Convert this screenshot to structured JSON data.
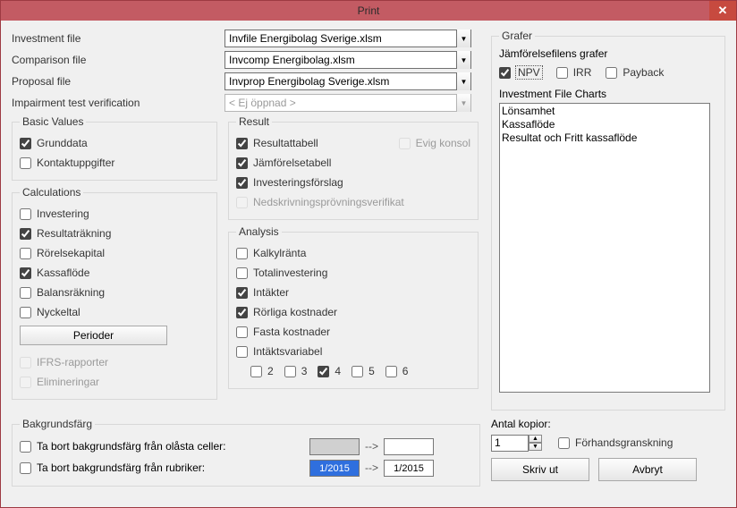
{
  "title": "Print",
  "files": {
    "investment_file_label": "Investment file",
    "comparison_file_label": "Comparison file",
    "proposal_file_label": "Proposal file",
    "impairment_label": "Impairment test verification",
    "investment_file_value": "Invfile Energibolag Sverige.xlsm",
    "comparison_file_value": "Invcomp Energibolag.xlsm",
    "proposal_file_value": "Invprop Energibolag Sverige.xlsm",
    "impairment_value": "< Ej öppnad >"
  },
  "basic_values": {
    "legend": "Basic Values",
    "grunddata": {
      "label": "Grunddata",
      "checked": true
    },
    "kontaktuppgifter": {
      "label": "Kontaktuppgifter",
      "checked": false
    }
  },
  "calculations": {
    "legend": "Calculations",
    "investering": {
      "label": "Investering",
      "checked": false
    },
    "resultatrakning": {
      "label": "Resultaträkning",
      "checked": true
    },
    "rorelsekapital": {
      "label": "Rörelsekapital",
      "checked": false
    },
    "kassaflode": {
      "label": "Kassaflöde",
      "checked": true
    },
    "balansrakning": {
      "label": "Balansräkning",
      "checked": false
    },
    "nyckeltal": {
      "label": "Nyckeltal",
      "checked": false
    },
    "perioder_btn": "Perioder",
    "ifrs": {
      "label": "IFRS-rapporter",
      "checked": false
    },
    "elimineringar": {
      "label": "Elimineringar",
      "checked": false
    }
  },
  "result": {
    "legend": "Result",
    "resultattabell": {
      "label": "Resultattabell",
      "checked": true
    },
    "jamforelsetabell": {
      "label": "Jämförelsetabell",
      "checked": true
    },
    "investeringsforslag": {
      "label": "Investeringsförslag",
      "checked": true
    },
    "nedskrivning": {
      "label": "Nedskrivningsprövningsverifikat",
      "checked": false
    },
    "evig_konsol": {
      "label": "Evig konsol",
      "checked": false
    }
  },
  "analysis": {
    "legend": "Analysis",
    "kalkylranta": {
      "label": "Kalkylränta",
      "checked": false
    },
    "totalinvestering": {
      "label": "Totalinvestering",
      "checked": false
    },
    "intakter": {
      "label": "Intäkter",
      "checked": true
    },
    "rorliga": {
      "label": "Rörliga kostnader",
      "checked": true
    },
    "fasta": {
      "label": "Fasta kostnader",
      "checked": false
    },
    "intaktsvariabel": {
      "label": "Intäktsvariabel",
      "checked": false
    },
    "n2": {
      "label": "2",
      "checked": false
    },
    "n3": {
      "label": "3",
      "checked": false
    },
    "n4": {
      "label": "4",
      "checked": true
    },
    "n5": {
      "label": "5",
      "checked": false
    },
    "n6": {
      "label": "6",
      "checked": false
    }
  },
  "grafer": {
    "legend": "Grafer",
    "jamforelse_label": "Jämförelsefilens grafer",
    "npv": {
      "label": "NPV",
      "checked": true
    },
    "irr": {
      "label": "IRR",
      "checked": false
    },
    "payback": {
      "label": "Payback",
      "checked": false
    },
    "list_label": "Investment File Charts",
    "items": [
      "Lönsamhet",
      "Kassaflöde",
      "Resultat och Fritt kassaflöde"
    ]
  },
  "bg_color": {
    "legend": "Bakgrundsfärg",
    "olasta": {
      "label": "Ta bort bakgrundsfärg från olåsta celler:",
      "checked": false
    },
    "rubriker": {
      "label": "Ta bort bakgrundsfärg från rubriker:",
      "checked": false
    },
    "arrow": "-->",
    "date_from": "1/2015",
    "date_to": "1/2015"
  },
  "copies": {
    "label": "Antal kopior:",
    "value": "1",
    "preview": {
      "label": "Förhandsgranskning",
      "checked": false
    }
  },
  "footer": {
    "skriv_ut": "Skriv ut",
    "avbryt": "Avbryt"
  }
}
